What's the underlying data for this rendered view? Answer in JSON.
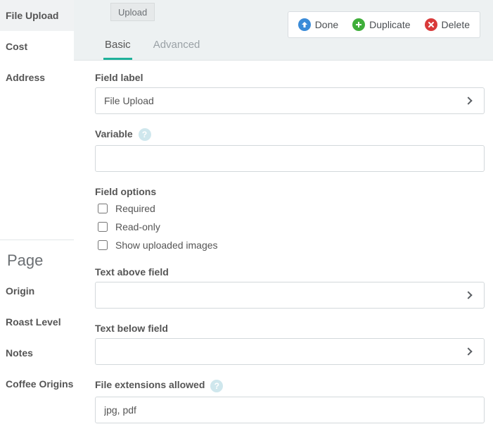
{
  "sidebar": {
    "fields": [
      {
        "label": "File Upload",
        "active": true
      },
      {
        "label": "Cost",
        "active": false
      },
      {
        "label": "Address",
        "active": false
      }
    ],
    "page_heading": "Page",
    "pages": [
      {
        "label": "Origin"
      },
      {
        "label": "Roast Level"
      },
      {
        "label": "Notes"
      },
      {
        "label": "Coffee Origins"
      }
    ]
  },
  "top": {
    "upload_label": "Upload",
    "actions": {
      "done": "Done",
      "duplicate": "Duplicate",
      "delete": "Delete"
    },
    "tabs": {
      "basic": "Basic",
      "advanced": "Advanced"
    }
  },
  "form": {
    "field_label_label": "Field label",
    "field_label_value": "File Upload",
    "variable_label": "Variable",
    "variable_value": "",
    "field_options_label": "Field options",
    "opt_required": "Required",
    "opt_readonly": "Read-only",
    "opt_show_images": "Show uploaded images",
    "text_above_label": "Text above field",
    "text_above_value": "",
    "text_below_label": "Text below field",
    "text_below_value": "",
    "extensions_label": "File extensions allowed",
    "extensions_value": "jpg, pdf"
  }
}
